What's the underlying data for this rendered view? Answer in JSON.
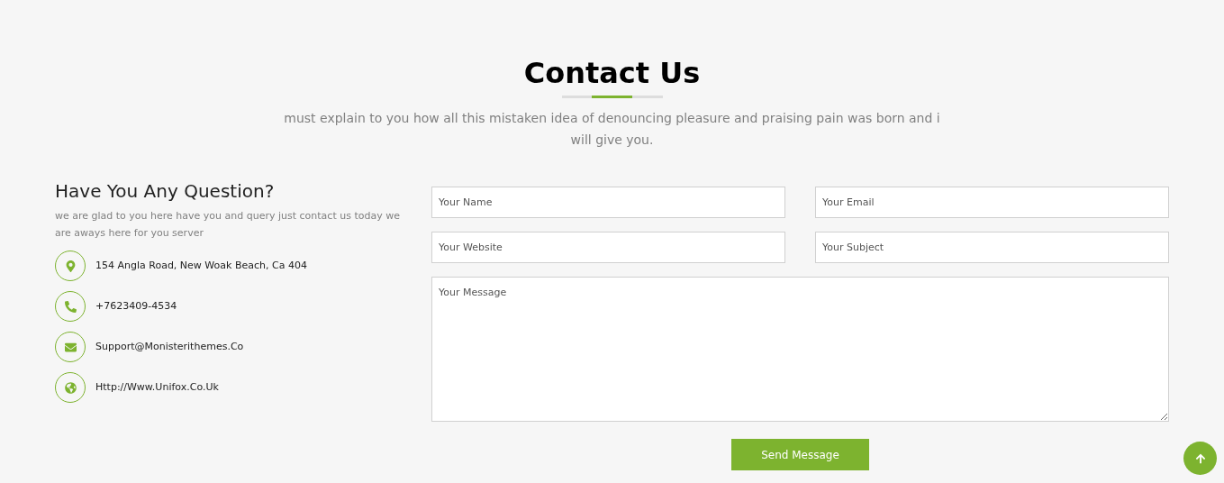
{
  "header": {
    "title": "Contact Us",
    "subtitle": "must explain to you how all this mistaken idea of denouncing pleasure and praising pain was born and i will give you."
  },
  "info": {
    "heading": "Have You Any Question?",
    "text": "we are glad to you here have you and query just contact us today we are aways here for you server",
    "items": [
      {
        "kind": "location",
        "text": "154 Angla Road, New Woak Beach, Ca 404"
      },
      {
        "kind": "phone",
        "text": "+7623409-4534"
      },
      {
        "kind": "email",
        "text": "Support@Monisterithemes.Co"
      },
      {
        "kind": "web",
        "text": "Http://Www.Unifox.Co.Uk"
      }
    ]
  },
  "form": {
    "fields": [
      {
        "kind": "input",
        "placeholder": "Your Name"
      },
      {
        "kind": "input",
        "placeholder": "Your Email"
      },
      {
        "kind": "input",
        "placeholder": "Your Website"
      },
      {
        "kind": "input",
        "placeholder": "Your Subject"
      },
      {
        "kind": "textarea",
        "placeholder": "Your Message"
      }
    ],
    "submit": "Send Message"
  }
}
